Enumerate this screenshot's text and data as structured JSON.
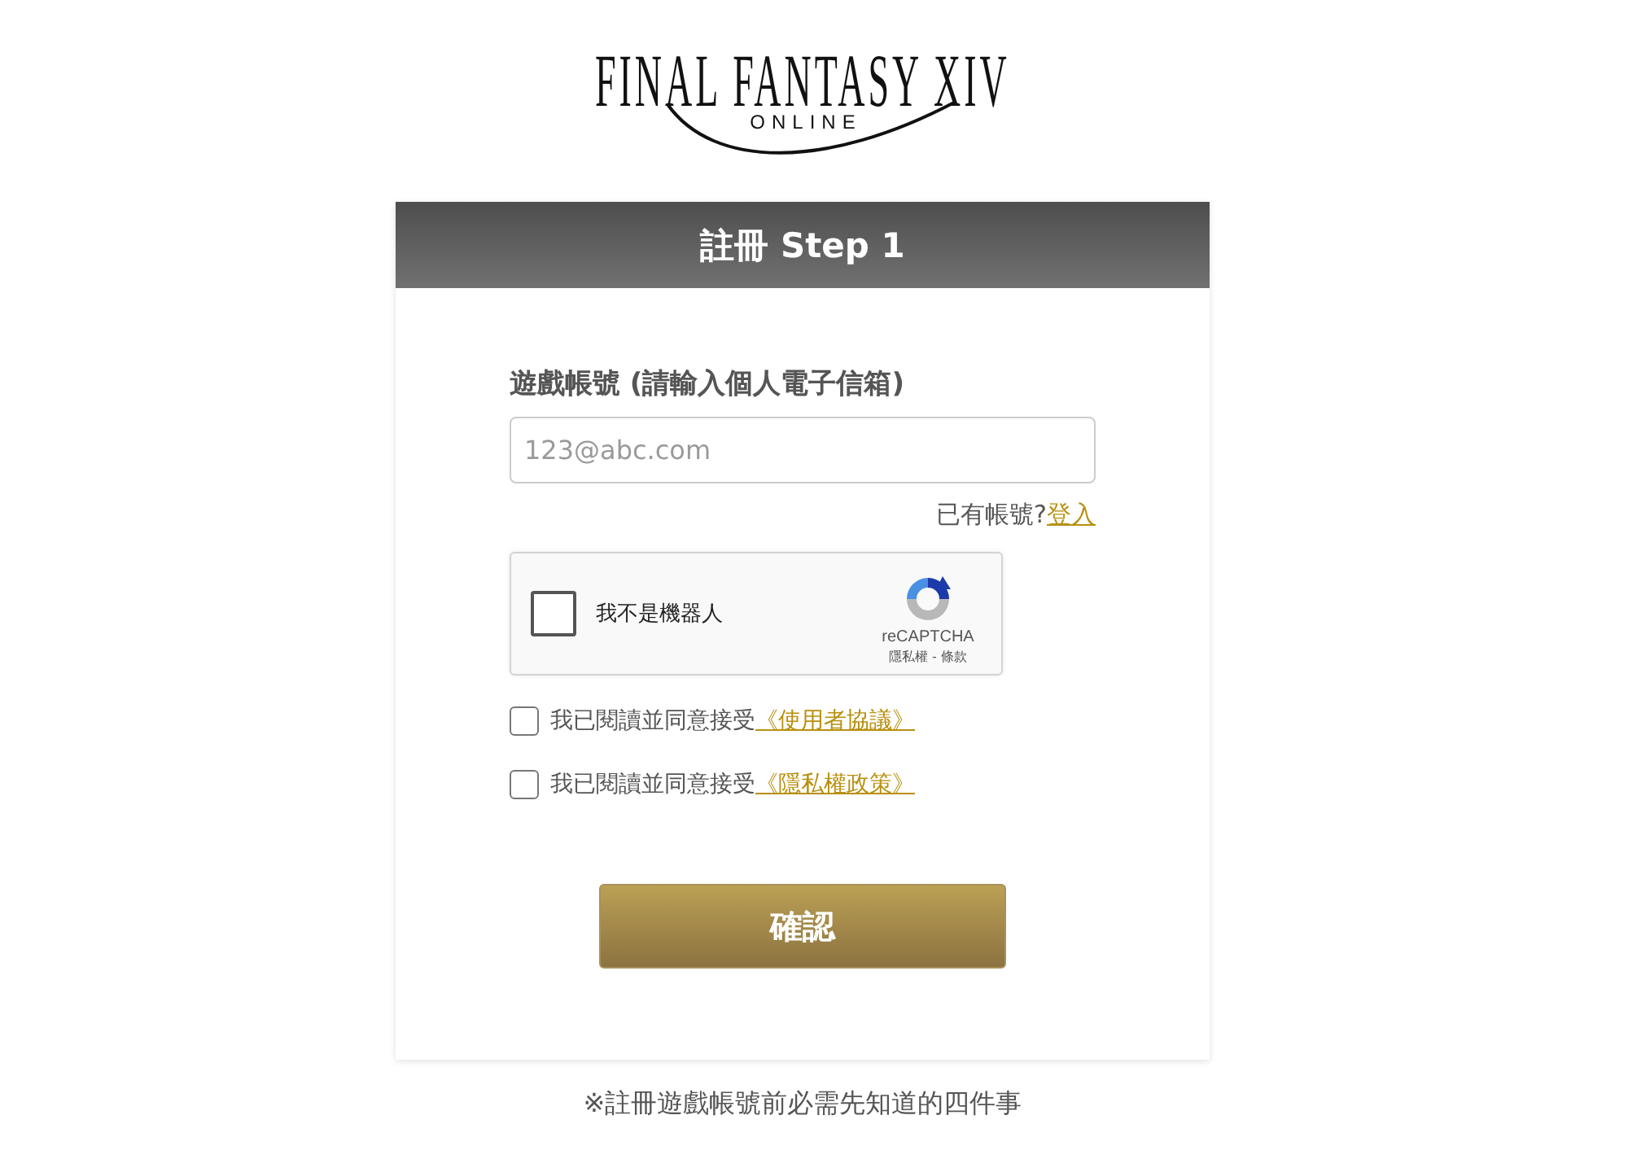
{
  "logo": {
    "title": "FINAL FANTASY XIV",
    "subtitle": "ONLINE"
  },
  "card": {
    "title": "註冊 Step 1"
  },
  "email": {
    "label": "遊戲帳號 (請輸入個人電子信箱)",
    "placeholder": "123@abc.com"
  },
  "login_prompt": {
    "text": "已有帳號?",
    "link": "登入"
  },
  "captcha": {
    "label": "我不是機器人",
    "checked": false,
    "brand": "reCAPTCHA",
    "links": "隱私權 - 條款"
  },
  "agreements": [
    {
      "text": "我已閱讀並同意接受",
      "link": "《使用者協議》",
      "checked": false
    },
    {
      "text": "我已閱讀並同意接受",
      "link": "《隱私權政策》",
      "checked": false
    }
  ],
  "submit": {
    "label": "確認"
  },
  "footer_note": "※註冊遊戲帳號前必需先知道的四件事"
}
